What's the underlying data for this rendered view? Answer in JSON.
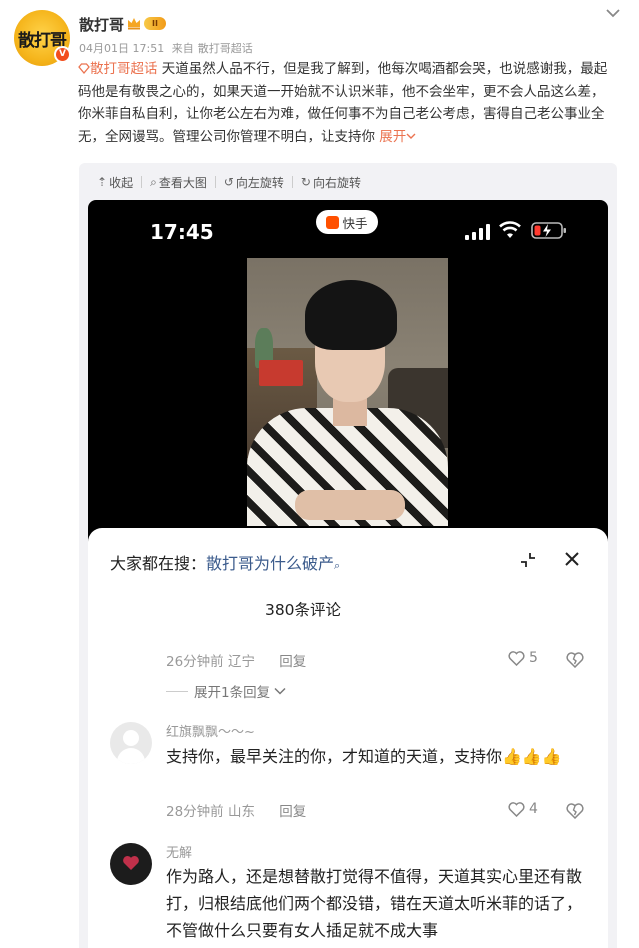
{
  "post": {
    "avatar_text": "散打哥",
    "username": "散打哥",
    "level": "II",
    "date": "04月01日 17:51",
    "source_prefix": "来自",
    "source": "散打哥超话",
    "topic": "散打哥超话",
    "body": "天道虽然人品不行，但是我了解到，他每次喝酒都会哭，也说感谢我，最起码他是有敬畏之心的，如果天道一开始就不认识米菲，他不会坐牢，更不会人品这么差，你米菲自私自利，让你老公左右为难，做任何事不为自己老公考虑，害得自己老公事业全无，全网谩骂。管理公司你管理不明白，让支持你",
    "expand_label": "展开"
  },
  "toolbar": {
    "collapse": "收起",
    "view_large": "查看大图",
    "rotate_left": "向左旋转",
    "rotate_right": "向右旋转"
  },
  "phone": {
    "time": "17:45",
    "app_name": "快手"
  },
  "sheet": {
    "search_prefix": "大家都在搜：",
    "search_query": "散打哥为什么破产",
    "comment_count": "380条评论",
    "comments": [
      {
        "time": "26分钟前",
        "location": "辽宁",
        "reply_label": "回复",
        "likes": "5",
        "expand_replies": "展开1条回复"
      },
      {
        "name": "红旗飘飘～～~",
        "text": "支持你，最早关注的你，才知道的天道，支持你👍👍👍",
        "time": "28分钟前",
        "location": "山东",
        "reply_label": "回复",
        "likes": "4"
      },
      {
        "name": "无解",
        "text": "作为路人，还是想替散打觉得不值得，天道其实心里还有散打，归根结底他们两个都没错，错在天道太听米菲的话了，不管做什么只要有女人插足就不成大事"
      }
    ]
  },
  "colors": {
    "accent": "#eb7350",
    "link_blue": "#3b5b8c",
    "meta_gray": "#999999"
  }
}
